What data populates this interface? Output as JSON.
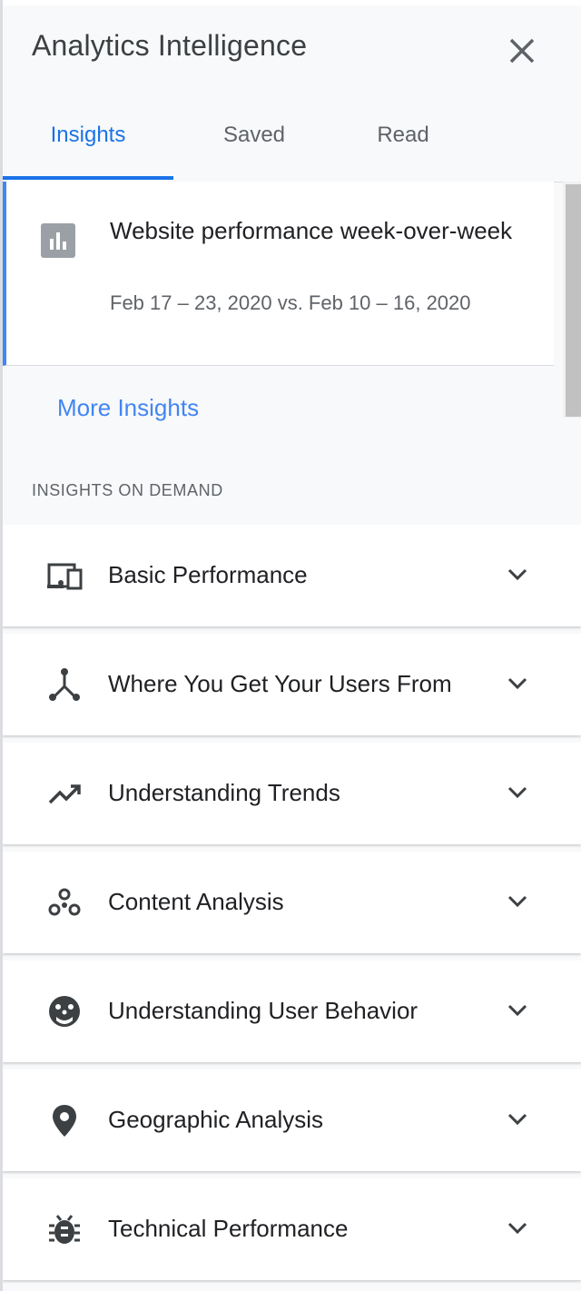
{
  "header": {
    "title": "Analytics Intelligence",
    "close_icon": "close-icon"
  },
  "tabs": [
    {
      "label": "Insights",
      "active": true
    },
    {
      "label": "Saved",
      "active": false
    },
    {
      "label": "Read",
      "active": false
    }
  ],
  "insight_card": {
    "icon": "bar-chart-icon",
    "title": "Website performance week-over-week",
    "date_range": "Feb 17 – 23, 2020 vs. Feb 10 – 16, 2020"
  },
  "more_insights": "More Insights",
  "section_label": "INSIGHTS ON DEMAND",
  "categories": [
    {
      "label": "Basic Performance",
      "icon": "devices-icon"
    },
    {
      "label": "Where You Get Your Users From",
      "icon": "call-split-icon"
    },
    {
      "label": "Understanding Trends",
      "icon": "trending-up-icon"
    },
    {
      "label": "Content Analysis",
      "icon": "bubbles-icon"
    },
    {
      "label": "Understanding User Behavior",
      "icon": "face-icon"
    },
    {
      "label": "Geographic Analysis",
      "icon": "location-pin-icon"
    },
    {
      "label": "Technical Performance",
      "icon": "bug-icon"
    }
  ],
  "colors": {
    "accent": "#1a73e8",
    "link": "#4285f4",
    "text": "#202124",
    "muted": "#5f6368",
    "background": "#f8f9fa"
  }
}
